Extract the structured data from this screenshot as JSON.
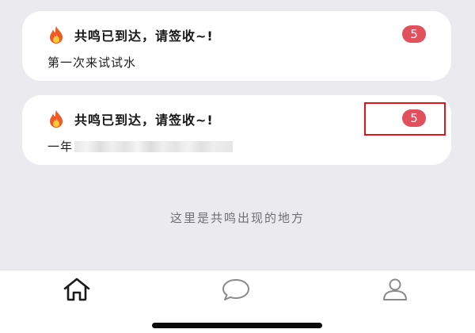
{
  "feed": {
    "cards": [
      {
        "icon": "fire-icon",
        "title": "共鸣已到达，请签收~!",
        "body": "第一次来试试水",
        "badge": "5"
      },
      {
        "icon": "fire-icon",
        "title": "共鸣已到达，请签收~!",
        "body": "一年",
        "badge": "5",
        "body_redacted": true
      }
    ],
    "empty_hint": "这里是共鸣出现的地方"
  },
  "tabbar": {
    "items": [
      {
        "icon": "home-icon",
        "active": true
      },
      {
        "icon": "chat-bubble-icon",
        "active": false
      },
      {
        "icon": "person-icon",
        "active": false
      }
    ]
  },
  "colors": {
    "background": "#ebebef",
    "card": "#ffffff",
    "badge": "#e2505e",
    "highlight": "#e0151b",
    "active_icon": "#1a1a1a",
    "inactive_icon": "#8a8a8e"
  }
}
